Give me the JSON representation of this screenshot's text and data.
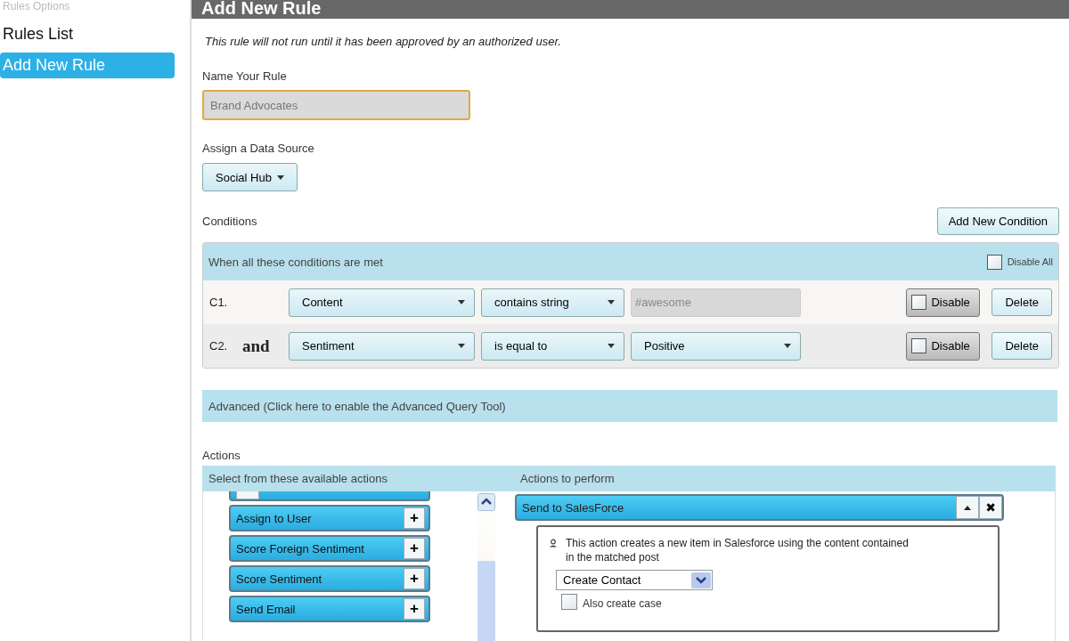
{
  "sidebar": {
    "heading": "Rules Options",
    "items": [
      {
        "label": "Rules List",
        "selected": false
      },
      {
        "label": "Add New Rule",
        "selected": true
      }
    ]
  },
  "header": {
    "title": "Add New Rule"
  },
  "notice": "This rule will not run until it has been approved by an authorized user.",
  "name_field": {
    "label": "Name Your Rule",
    "value": "Brand Advocates"
  },
  "data_source": {
    "label": "Assign a Data Source",
    "value": "Social Hub"
  },
  "conditions": {
    "label": "Conditions",
    "add_button": "Add New Condition",
    "header": "When all these conditions are met",
    "disable_all": {
      "label": "Disable All",
      "checked": false
    },
    "rows": [
      {
        "id_label": "C1.",
        "field": "Content",
        "operator": "contains string",
        "value": {
          "kind": "input",
          "text": "#awesome"
        },
        "disable": {
          "label": "Disable",
          "checked": false
        },
        "delete": "Delete"
      },
      {
        "id_label": "C2.",
        "joiner": "and",
        "field": "Sentiment",
        "operator": "is equal to",
        "value": {
          "kind": "select",
          "text": "Positive"
        },
        "disable": {
          "label": "Disable",
          "checked": false
        },
        "delete": "Delete"
      }
    ]
  },
  "advanced": "Advanced (Click here to enable the Advanced Query Tool)",
  "actions": {
    "label": "Actions",
    "available_header": "Select from these available actions",
    "available": [
      {
        "label": "Assign to User",
        "add": "+"
      },
      {
        "label": "Score Foreign Sentiment",
        "add": "+"
      },
      {
        "label": "Score Sentiment",
        "add": "+"
      },
      {
        "label": "Send Email",
        "add": "+"
      }
    ],
    "perform_header": "Actions to perform",
    "performed": [
      {
        "title": "Send to SalesForce",
        "expanded": true,
        "close": "✖",
        "description": "This action creates a new item in Salesforce using the content contained in the matched post",
        "select": "Create Contact",
        "also_case": {
          "label": "Also create case",
          "checked": false
        }
      }
    ]
  }
}
